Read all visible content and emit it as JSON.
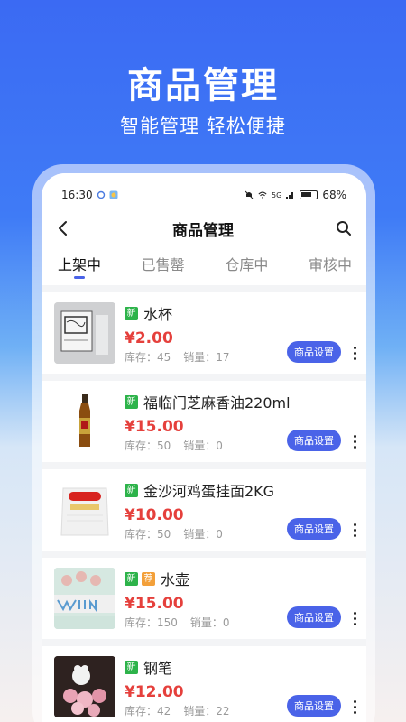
{
  "promo": {
    "title": "商品管理",
    "subtitle": "智能管理  轻松便捷"
  },
  "status_bar": {
    "time": "16:30",
    "battery": "68%",
    "signal": "5G"
  },
  "nav": {
    "title": "商品管理",
    "back_icon": "chevron-left-icon",
    "search_icon": "search-icon"
  },
  "tabs": [
    {
      "label": "上架中",
      "active": true
    },
    {
      "label": "已售罄",
      "active": false
    },
    {
      "label": "仓库中",
      "active": false
    },
    {
      "label": "审核中",
      "active": false
    }
  ],
  "items": [
    {
      "name": "水杯",
      "tags": [
        "新"
      ],
      "price": "¥2.00",
      "stock": "库存：45",
      "sales": "销量：17",
      "button": "商品设置"
    },
    {
      "name": "福临门芝麻香油220ml",
      "tags": [
        "新"
      ],
      "price": "¥15.00",
      "stock": "库存：50",
      "sales": "销量：0",
      "button": "商品设置"
    },
    {
      "name": "金沙河鸡蛋挂面2KG",
      "tags": [
        "新"
      ],
      "price": "¥10.00",
      "stock": "库存：50",
      "sales": "销量：0",
      "button": "商品设置"
    },
    {
      "name": "水壶",
      "tags": [
        "新",
        "荐"
      ],
      "price": "¥15.00",
      "stock": "库存：150",
      "sales": "销量：0",
      "button": "商品设置"
    },
    {
      "name": "钢笔",
      "tags": [
        "新"
      ],
      "price": "¥12.00",
      "stock": "库存：42",
      "sales": "销量：22",
      "button": "商品设置"
    }
  ],
  "colors": {
    "accent": "#4a63e8",
    "price": "#e5403c",
    "tag_new": "#2db34a",
    "tag_recommend": "#f3a03a"
  }
}
